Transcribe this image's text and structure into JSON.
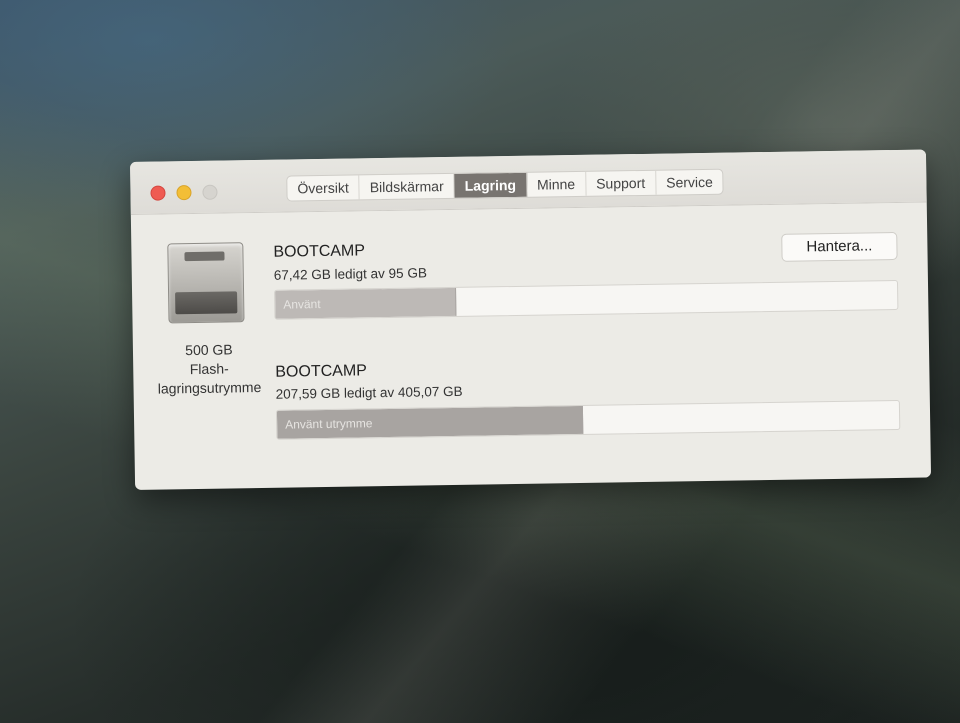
{
  "tabs": [
    {
      "label": "Översikt",
      "active": false
    },
    {
      "label": "Bildskärmar",
      "active": false
    },
    {
      "label": "Lagring",
      "active": true
    },
    {
      "label": "Minne",
      "active": false
    },
    {
      "label": "Support",
      "active": false
    },
    {
      "label": "Service",
      "active": false
    }
  ],
  "disk": {
    "caption_line1": "500 GB",
    "caption_line2": "Flash-",
    "caption_line3": "lagringsutrymme"
  },
  "manage_button": "Hantera...",
  "volumes": [
    {
      "name": "BOOTCAMP",
      "info": "67,42 GB ledigt av 95 GB",
      "bar_label": "Använt",
      "used_fraction": 0.29
    },
    {
      "name": "BOOTCAMP",
      "info": "207,59 GB ledigt av 405,07 GB",
      "bar_label": "Använt utrymme",
      "used_fraction": 0.49
    }
  ],
  "colors": {
    "active_tab": "#787470",
    "close": "#ef5b52",
    "minimize": "#f3be36"
  }
}
